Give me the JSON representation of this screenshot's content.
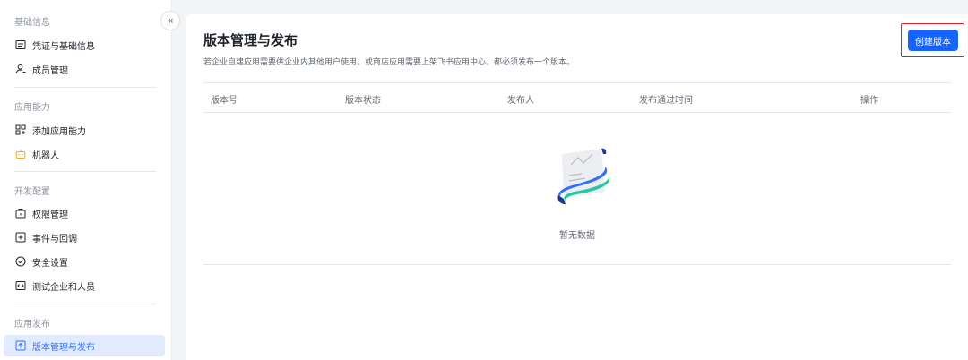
{
  "sidebar": {
    "groups": [
      {
        "title": "基础信息",
        "items": [
          {
            "label": "凭证与基础信息"
          },
          {
            "label": "成员管理"
          }
        ]
      },
      {
        "title": "应用能力",
        "items": [
          {
            "label": "添加应用能力"
          },
          {
            "label": "机器人"
          }
        ]
      },
      {
        "title": "开发配置",
        "items": [
          {
            "label": "权限管理"
          },
          {
            "label": "事件与回调"
          },
          {
            "label": "安全设置"
          },
          {
            "label": "测试企业和人员"
          }
        ]
      },
      {
        "title": "应用发布",
        "items": [
          {
            "label": "版本管理与发布"
          }
        ]
      }
    ],
    "collapse_glyph": "«"
  },
  "main": {
    "title": "版本管理与发布",
    "description": "若企业自建应用需要供企业内其他用户使用，或商店应用需要上架飞书应用中心，都必须发布一个版本。",
    "create_button": "创建版本",
    "table": {
      "columns": [
        "版本号",
        "版本状态",
        "发布人",
        "发布通过时间",
        "操作"
      ]
    },
    "empty_text": "暂无数据"
  },
  "colors": {
    "accent": "#1664ff",
    "active_bg": "#e1eaff",
    "highlight": "#e02020",
    "robot_icon": "#f5a623"
  }
}
